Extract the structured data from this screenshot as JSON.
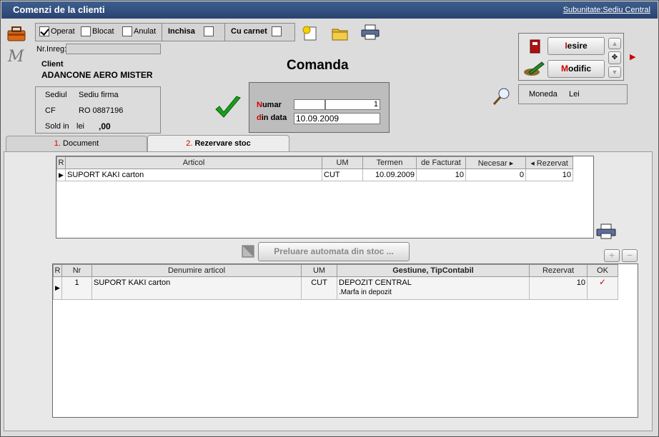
{
  "window": {
    "title": "Comenzi de la clienti",
    "subunit": "Subunitate:Sediu Central"
  },
  "flags": {
    "operat": "Operat",
    "blocat": "Blocat",
    "anulat": "Anulat",
    "inchisa": "Inchisa",
    "cu_carnet": "Cu carnet",
    "operat_checked": true
  },
  "header": {
    "nr_inreg_label": "Nr.Inreg:",
    "client_label": "Client",
    "client_name": "ADANCONE AERO MISTER",
    "sediul_label": "Sediul",
    "sediul_value": "Sediu firma",
    "cf_label": "CF",
    "cf_value": "RO 0887196",
    "sold_label": "Sold in",
    "sold_currency": "lei",
    "sold_value": ",00",
    "logo_letter": "M"
  },
  "order": {
    "title": "Comanda",
    "numar_label": "umar",
    "numar_initial": "N",
    "numar_value": "1",
    "data_label": "in data",
    "data_initial": "d",
    "data_value": "10.09.2009"
  },
  "actions": {
    "iesire_initial": "I",
    "iesire": "esire",
    "modifica_initial": "M",
    "modifica": "odific"
  },
  "currency": {
    "label": "Moneda",
    "value": "Lei"
  },
  "tabs": [
    {
      "num": "1.",
      "label": "Document"
    },
    {
      "num": "2.",
      "label": "Rezervare stoc"
    }
  ],
  "grid1": {
    "columns": [
      "R",
      "Articol",
      "UM",
      "Termen",
      "de Facturat",
      "Necesar",
      "Rezervat"
    ],
    "rows": [
      {
        "articol": "SUPORT KAKI carton",
        "um": "CUT",
        "termen": "10.09.2009",
        "facturat": "10",
        "necesar": "0",
        "rezervat": "10"
      }
    ]
  },
  "preluare": "Preluare automata din stoc ...",
  "grid2": {
    "columns": [
      "R",
      "Nr",
      "Denumire articol",
      "UM",
      "Gestiune, TipContabil",
      "Rezervat",
      "OK"
    ],
    "rows": [
      {
        "nr": "1",
        "denumire": "SUPORT KAKI carton",
        "um": "CUT",
        "gestiune": "DEPOZIT CENTRAL",
        "tip": ".Marfa in depozit",
        "rezervat": "10"
      }
    ]
  }
}
